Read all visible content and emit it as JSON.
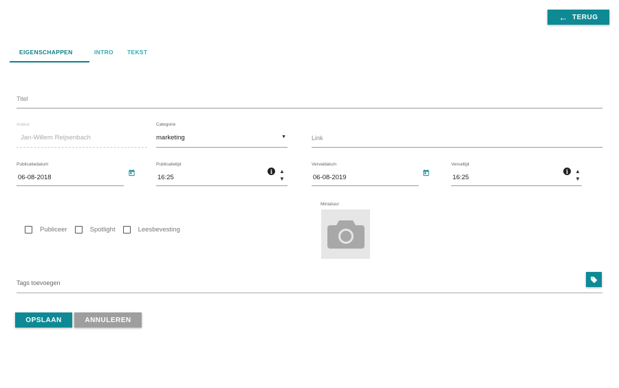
{
  "header": {
    "back_label": "TERUG"
  },
  "tabs": [
    {
      "label": "EIGENSCHAPPEN",
      "active": true
    },
    {
      "label": "INTRO",
      "active": false
    },
    {
      "label": "TEKST",
      "active": false
    }
  ],
  "form": {
    "title": {
      "placeholder": "Titel",
      "value": ""
    },
    "author": {
      "label": "Auteur",
      "value": "Jan-Willem Reijsenbach",
      "disabled": true
    },
    "category": {
      "label": "Categorie",
      "value": "marketing"
    },
    "link": {
      "placeholder": "Link",
      "value": ""
    },
    "publish_date": {
      "label": "Publicatiedatum",
      "value": "06-08-2018"
    },
    "publish_time": {
      "label": "Publicatietijd",
      "value": "16:25"
    },
    "expire_date": {
      "label": "Vervaldatum",
      "value": "06-08-2019"
    },
    "expire_time": {
      "label": "Vervaltijd",
      "value": "16:25"
    },
    "checkboxes": [
      {
        "label": "Publiceer",
        "checked": false
      },
      {
        "label": "Spotlight",
        "checked": false
      },
      {
        "label": "Leesbevesting",
        "checked": false
      }
    ],
    "thumbnail": {
      "label": "Miniatuur",
      "icon": "camera-icon"
    },
    "tags": {
      "placeholder": "Tags toevoegen",
      "icon": "tag-icon"
    }
  },
  "actions": {
    "save_label": "OPSLAAN",
    "cancel_label": "ANNULEREN"
  },
  "colors": {
    "accent": "#0e8a94",
    "secondary": "#9e9e9e"
  }
}
